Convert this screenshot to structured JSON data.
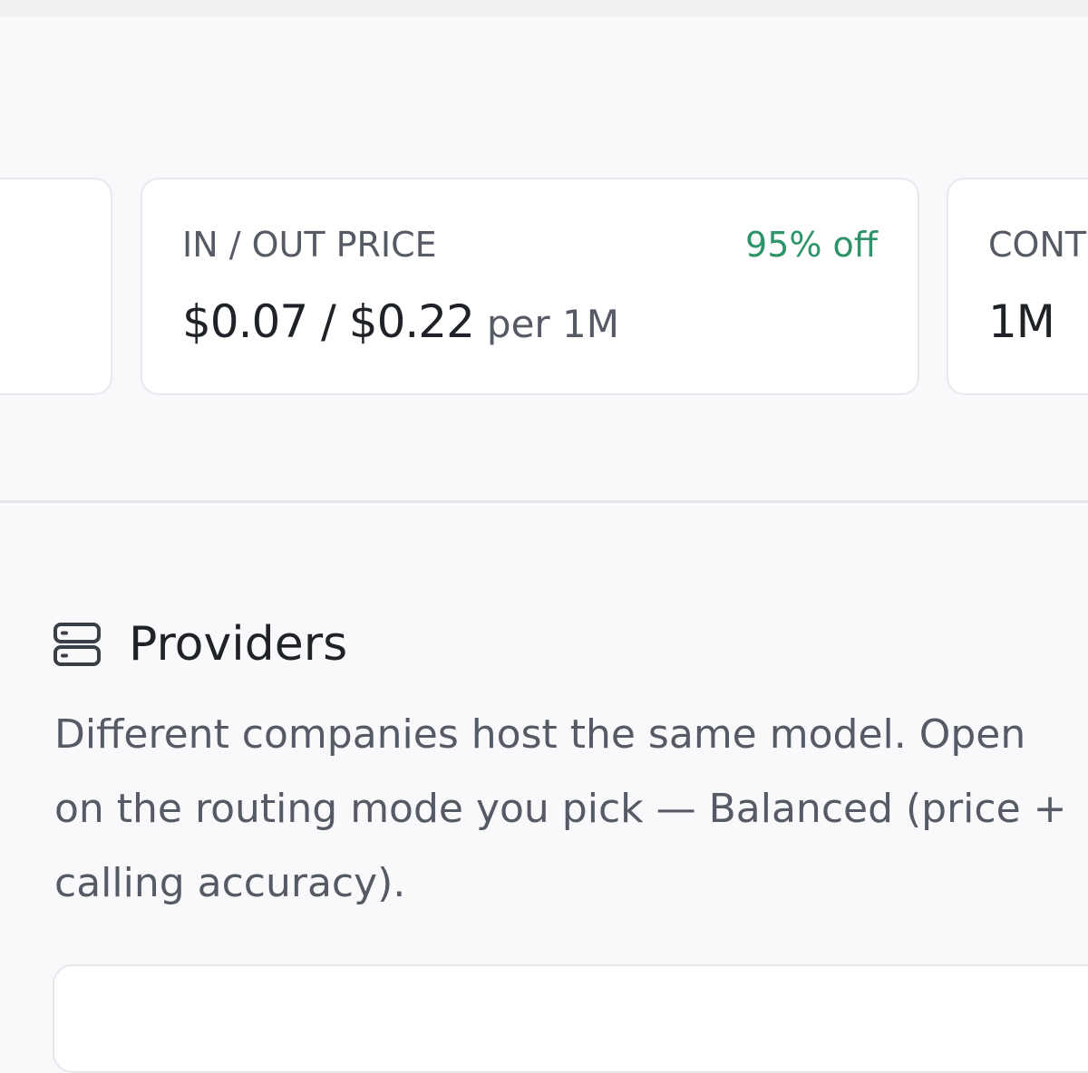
{
  "stats": {
    "price_card": {
      "label": "IN / OUT PRICE",
      "badge": "95% off",
      "value": "$0.07 / $0.22",
      "unit": "per 1M"
    },
    "context_card": {
      "label": "CONT",
      "value": "1M"
    }
  },
  "providers": {
    "icon": "server-stack-icon",
    "title": "Providers",
    "description_lines": [
      "Different companies host the same model. Open",
      "on the routing mode you pick — Balanced (price +",
      "calling accuracy)."
    ]
  },
  "colors": {
    "accent_green": "#2d9469",
    "text_primary": "#1f2328",
    "text_secondary": "#555a64",
    "card_border": "#e8e8ee",
    "page_background": "#f9f9fb"
  }
}
